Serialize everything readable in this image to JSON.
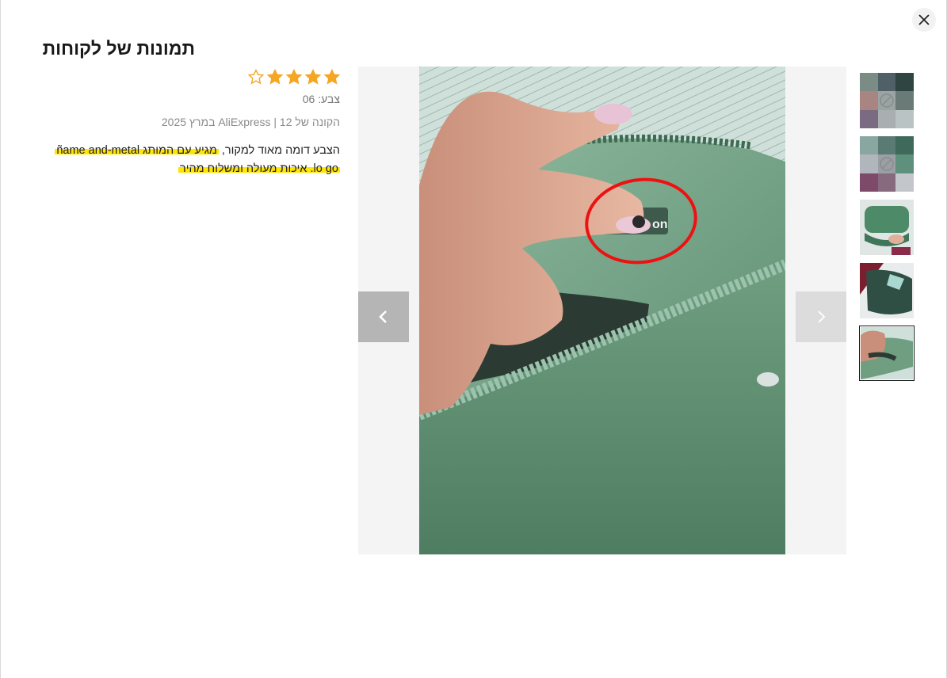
{
  "modal": {
    "title": "תמונות של לקוחות",
    "close_icon": "close-icon"
  },
  "review": {
    "rating": 4,
    "rating_max": 5,
    "color_line": "צבע: 06",
    "meta_line": "הקונה של 12 | AliExpress במרץ 2025",
    "text_plain": "הצבע דומה מאוד למקור, ",
    "text_highlight_1": "מגיע עם המותג ñame and-metal",
    "text_highlight_2": "lo go. איכות מעולה ומשלוח מהיר"
  },
  "viewer": {
    "prev_icon": "chevron-left-icon",
    "next_icon": "chevron-right-icon",
    "active_index": 4
  },
  "thumbnails": [
    {
      "kind": "blurred"
    },
    {
      "kind": "blurred"
    },
    {
      "kind": "photo"
    },
    {
      "kind": "photo"
    },
    {
      "kind": "photo"
    }
  ],
  "colors": {
    "star": "#f5a623",
    "highlight": "#ffe500",
    "bag_green": "#5f9476"
  }
}
